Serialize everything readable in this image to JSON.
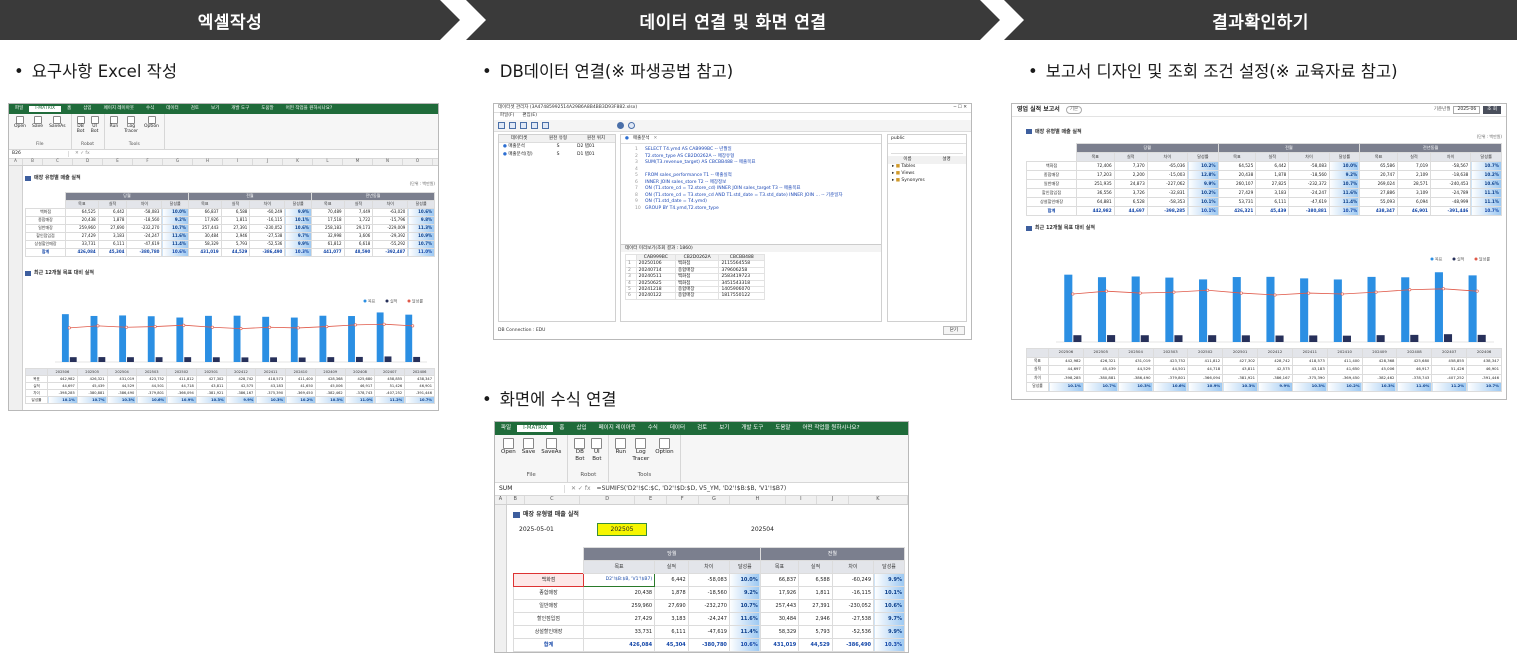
{
  "steps": [
    "엑셀작성",
    "데이터 연결 및 화면 연결",
    "결과확인하기"
  ],
  "bullets": {
    "excel": "요구사항 Excel 작성",
    "db": "DB데이터 연결(※ 파생공법 참고)",
    "formula": "화면에 수식 연결",
    "report": "보고서 디자인 및 조회 조건 설정(※ 교육자료 참고)"
  },
  "excel_menu": [
    "파일",
    "I-MATRIX",
    "홈",
    "삽입",
    "페이지 레이아웃",
    "수식",
    "데이터",
    "검토",
    "보기",
    "개발 도구",
    "도움말",
    "어떤 작업을 원하시나요?"
  ],
  "ribbon": {
    "file_items": [
      "Open",
      "Save",
      "SaveAs"
    ],
    "file_group": "File",
    "robot_items": [
      "DB\nBot",
      "UI\nBot"
    ],
    "robot_group": "Robot",
    "tools_items": [
      "Run",
      "Log\nTracer",
      "Option"
    ],
    "tools_group": "Tools"
  },
  "sheet": {
    "cell_ref_1": "B26",
    "cell_ref_2": "SUM",
    "formula": "=SUMIFS('D2'!$C:$C, 'D2'!$D:$D, V5_YM, 'D2'!$B:$B, 'V1'!$B7)",
    "cols_small": [
      "A",
      "B",
      "C",
      "D",
      "E",
      "F",
      "G",
      "H",
      "I",
      "J",
      "K",
      "L",
      "M",
      "N",
      "O"
    ],
    "cols_big": [
      "A",
      "B",
      "C",
      "D",
      "E",
      "F",
      "G",
      "H",
      "I",
      "J",
      "K"
    ],
    "section1_title": "매장 유형별 매출 실적",
    "section2_title": "최근 12개월 목표 대비 실적",
    "unit": "(단위 : 백만원)",
    "date_value": "2025-05-01",
    "cur_ym": "202505",
    "prev_ym": "202504",
    "edit_cell": "D2'!$B:$B, 'V1'!$B7)",
    "groups": [
      "당월",
      "전월",
      "전년동월"
    ],
    "sub": [
      "목표",
      "실적",
      "차이",
      "달성률"
    ],
    "rows": [
      {
        "label": "백화점",
        "cur": [
          "64,525",
          "6,442",
          "-58,083",
          "10.0%"
        ],
        "prev": [
          "66,837",
          "6,588",
          "-60,249",
          "9.9%"
        ],
        "ly": [
          "70,489",
          "7,449",
          "-63,020",
          "10.6%"
        ]
      },
      {
        "label": "종합매장",
        "cur": [
          "20,438",
          "1,878",
          "-18,560",
          "9.2%"
        ],
        "prev": [
          "17,926",
          "1,811",
          "-16,115",
          "10.1%"
        ],
        "ly": [
          "17,518",
          "1,722",
          "-15,796",
          "9.8%"
        ]
      },
      {
        "label": "일반매장",
        "cur": [
          "259,960",
          "27,690",
          "-232,270",
          "10.7%"
        ],
        "prev": [
          "257,443",
          "27,391",
          "-230,052",
          "10.6%"
        ],
        "ly": [
          "258,183",
          "29,173",
          "-229,009",
          "11.3%"
        ]
      },
      {
        "label": "할인점입점",
        "cur": [
          "27,429",
          "3,183",
          "-24,247",
          "11.6%"
        ],
        "prev": [
          "30,484",
          "2,946",
          "-27,538",
          "9.7%"
        ],
        "ly": [
          "32,998",
          "3,606",
          "-29,392",
          "10.9%"
        ]
      },
      {
        "label": "상설할인매장",
        "cur": [
          "33,731",
          "6,111",
          "-47,619",
          "11.4%"
        ],
        "prev": [
          "58,329",
          "5,793",
          "-52,536",
          "9.9%"
        ],
        "ly": [
          "61,812",
          "6,618",
          "-55,292",
          "10.7%"
        ]
      },
      {
        "label": "합계",
        "cur": [
          "426,084",
          "45,304",
          "-380,780",
          "10.6%"
        ],
        "prev": [
          "431,019",
          "44,529",
          "-386,490",
          "10.3%"
        ],
        "ly": [
          "441,077",
          "48,590",
          "-392,487",
          "11.0%"
        ]
      }
    ]
  },
  "report": {
    "title": "영업 실적 보고서",
    "badge": "기본",
    "cond_label": "기준년월",
    "cond_value": "2025-06",
    "btn": "조 회",
    "unit": "(단위 : 백만원)",
    "section1_title": "매장 유형별 매출 실적",
    "section2_title": "최근 12개월 목표 대비 실적",
    "rows": [
      {
        "label": "백화점",
        "cur": [
          "72,406",
          "7,370",
          "-65,036",
          "10.2%"
        ],
        "prev": [
          "64,525",
          "6,442",
          "-58,083",
          "10.0%"
        ],
        "ly": [
          "65,586",
          "7,019",
          "-58,567",
          "10.7%"
        ]
      },
      {
        "label": "종합매장",
        "cur": [
          "17,203",
          "2,200",
          "-15,003",
          "12.8%"
        ],
        "prev": [
          "20,438",
          "1,878",
          "-18,560",
          "9.2%"
        ],
        "ly": [
          "20,747",
          "2,109",
          "-18,638",
          "10.2%"
        ]
      },
      {
        "label": "일반매장",
        "cur": [
          "251,935",
          "24,873",
          "-227,062",
          "9.9%"
        ],
        "prev": [
          "260,107",
          "27,825",
          "-232,372",
          "10.7%"
        ],
        "ly": [
          "269,024",
          "28,571",
          "-240,453",
          "10.6%"
        ]
      },
      {
        "label": "할인점입점",
        "cur": [
          "36,556",
          "3,726",
          "-32,831",
          "10.2%"
        ],
        "prev": [
          "27,429",
          "3,183",
          "-24,247",
          "11.6%"
        ],
        "ly": [
          "27,886",
          "3,109",
          "-24,789",
          "11.1%"
        ]
      },
      {
        "label": "상설할인매장",
        "cur": [
          "64,881",
          "6,528",
          "-58,353",
          "10.1%"
        ],
        "prev": [
          "53,731",
          "6,111",
          "-47,619",
          "11.4%"
        ],
        "ly": [
          "55,093",
          "6,094",
          "-48,999",
          "11.1%"
        ]
      },
      {
        "label": "합계",
        "cur": [
          "442,982",
          "44,697",
          "-398,285",
          "10.1%"
        ],
        "prev": [
          "426,321",
          "45,439",
          "-380,881",
          "10.7%"
        ],
        "ly": [
          "438,347",
          "46,901",
          "-391,446",
          "10.7%"
        ]
      }
    ]
  },
  "chart_data": {
    "type": "bar",
    "categories": [
      "202506",
      "202505",
      "202504",
      "202503",
      "202502",
      "202501",
      "202412",
      "202411",
      "202410",
      "202409",
      "202408",
      "202407",
      "202406"
    ],
    "series": [
      {
        "name": "목표",
        "values": [
          442982,
          426321,
          431019,
          423752,
          411812,
          427302,
          428742,
          418573,
          411400,
          428368,
          425680,
          458855,
          438347
        ]
      },
      {
        "name": "실적",
        "values": [
          44697,
          45439,
          44529,
          44501,
          44718,
          43811,
          42575,
          43183,
          41650,
          45006,
          46917,
          51426,
          46901
        ]
      },
      {
        "name": "달성률",
        "values": [
          10.1,
          10.7,
          10.3,
          10.5,
          10.9,
          10.3,
          9.9,
          10.3,
          10.1,
          10.5,
          11.0,
          11.2,
          10.7
        ]
      }
    ],
    "row_labels": [
      "목표",
      "실적",
      "차이",
      "달성률"
    ],
    "diff_values": [
      "-398,285",
      "-380,881",
      "-386,490",
      "-379,801",
      "-366,094",
      "-381,921",
      "-386,167",
      "-375,390",
      "-369,450",
      "-382,462",
      "-378,743",
      "-407,252",
      "-391,446"
    ],
    "rate_labels": [
      "10.1%",
      "10.7%",
      "10.3%",
      "10.6%",
      "10.9%",
      "10.3%",
      "9.9%",
      "10.3%",
      "10.2%",
      "10.3%",
      "11.0%",
      "11.2%",
      "10.7%"
    ]
  },
  "db": {
    "title": "데이터셋 관리자 (3A47485992514A29B6A8B4BB3D93F882.xlsx)",
    "menu": [
      "파일(F)",
      "편집(E)"
    ],
    "tab": "매출분석",
    "left_cols": [
      "데이터셋",
      "원천 유형",
      "원천 위치"
    ],
    "left_rows": [
      [
        "매출분석",
        "S",
        "D2 탭01"
      ],
      [
        "매출분석(정)",
        "S",
        "D1 탭01"
      ]
    ],
    "sql": [
      "SELECT T4.ymd AS CAB999BC -- 년월일",
      "T2.store_type AS CB2D0262A -- 매장유형",
      "SUM(T3.revenue_target) AS CBCBB488 -- 매출목표",
      "",
      "FROM    sales_performance T1 -- 매출실적",
      "INNER JOIN sales_store T2 -- 매장정보",
      "ON (T1.store_cd = T2.store_cd) INNER JOIN sales_target T3 -- 매출목표",
      "ON (T1.store_cd = T3.store_cd AND T1.std_date = T3.std_date) INNER JOIN ... -- 기준일자",
      "ON (T1.std_date = T4.ymd)",
      "GROUP BY T4.ymd,T2.store_type"
    ],
    "result_title": "데이터 미리보기(조회 결과 : 1860)",
    "result_cols": [
      "CAB999BC",
      "CB2D0262A",
      "CBCBB488"
    ],
    "result_rows": [
      [
        "20250106",
        "백화점",
        "2115564558"
      ],
      [
        "20240714",
        "종합매장",
        "379606258"
      ],
      [
        "20240511",
        "백화점",
        "2583419723"
      ],
      [
        "20250625",
        "백화점",
        "3451543318"
      ],
      [
        "20241218",
        "종합매장",
        "1405906070"
      ],
      [
        "20240122",
        "종합매장",
        "1817550122"
      ]
    ],
    "right_label": "public",
    "right_cols": [
      "이름",
      "설명"
    ],
    "tree": [
      "Tables",
      "Views",
      "Synonyms"
    ],
    "status": "DB Connection : EDU",
    "close_btn": "닫기"
  },
  "colors": {
    "header_bg": "#3a3a3a",
    "excel_green": "#1f6b3a",
    "bar_target": "#2b8fe3",
    "bar_actual": "#27305a",
    "line_rate": "#e05a4a"
  }
}
